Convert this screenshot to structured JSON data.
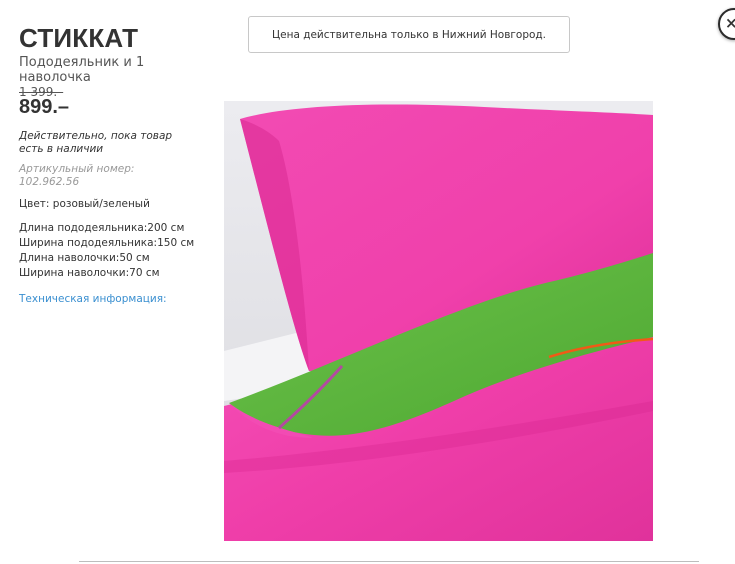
{
  "product": {
    "name": "СТИККАТ",
    "type": "Пододеяльник и 1 наволочка",
    "old_price": "1 399.–",
    "new_price": "899.–",
    "availability": "Действительно, пока товар есть в наличии",
    "article": "Артикульный номер: 102.962.56",
    "color": "Цвет: розовый/зеленый",
    "dimensions": [
      "Длина пододеяльника:200 см",
      "Ширина пододеяльника:150 см",
      "Длина наволочки:50 см",
      "Ширина наволочки:70 см"
    ],
    "tech_link": "Техническая информация:"
  },
  "notice": {
    "text": "Цена действительна только в Нижний Новгород."
  },
  "close": {
    "icon": "close-icon",
    "glyph": "×"
  },
  "image": {
    "subject": "pink and green duvet cover and pillowcase",
    "colors": {
      "pink": "#f23fae",
      "green": "#5cb83a",
      "orange_piping": "#f05a16",
      "background": "#e6e6ea"
    }
  },
  "colors": {
    "text": "#333333",
    "muted": "#999999",
    "link": "#3a8fd0",
    "border": "#c8c8c8"
  }
}
